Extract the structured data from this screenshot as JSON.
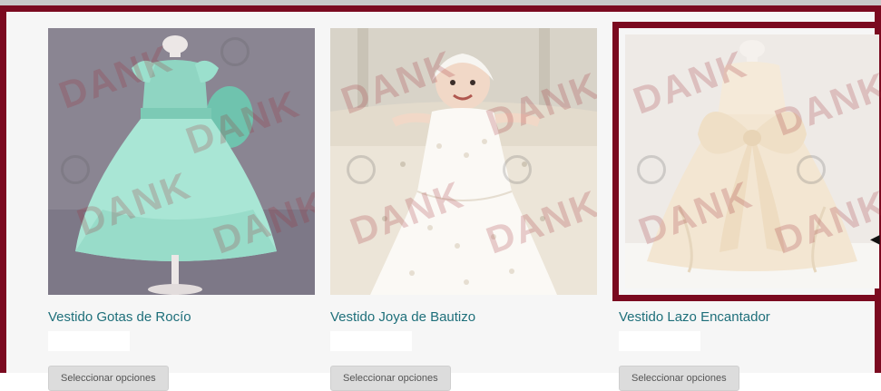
{
  "products": [
    {
      "name": "Vestido Gotas de Rocío",
      "button": "Seleccionar opciones",
      "watermark": "DANK",
      "selected": false
    },
    {
      "name": "Vestido Joya de Bautizo",
      "button": "Seleccionar opciones",
      "watermark": "DANK",
      "selected": false
    },
    {
      "name": "Vestido Lazo Encantador",
      "button": "Seleccionar opciones",
      "watermark": "DANK",
      "selected": true
    }
  ],
  "colors": {
    "frame": "#7b0a20",
    "title": "#1e6f7a",
    "button_bg": "#dcdcdc"
  },
  "pointer_icon": "left-arrow-pointer-icon"
}
